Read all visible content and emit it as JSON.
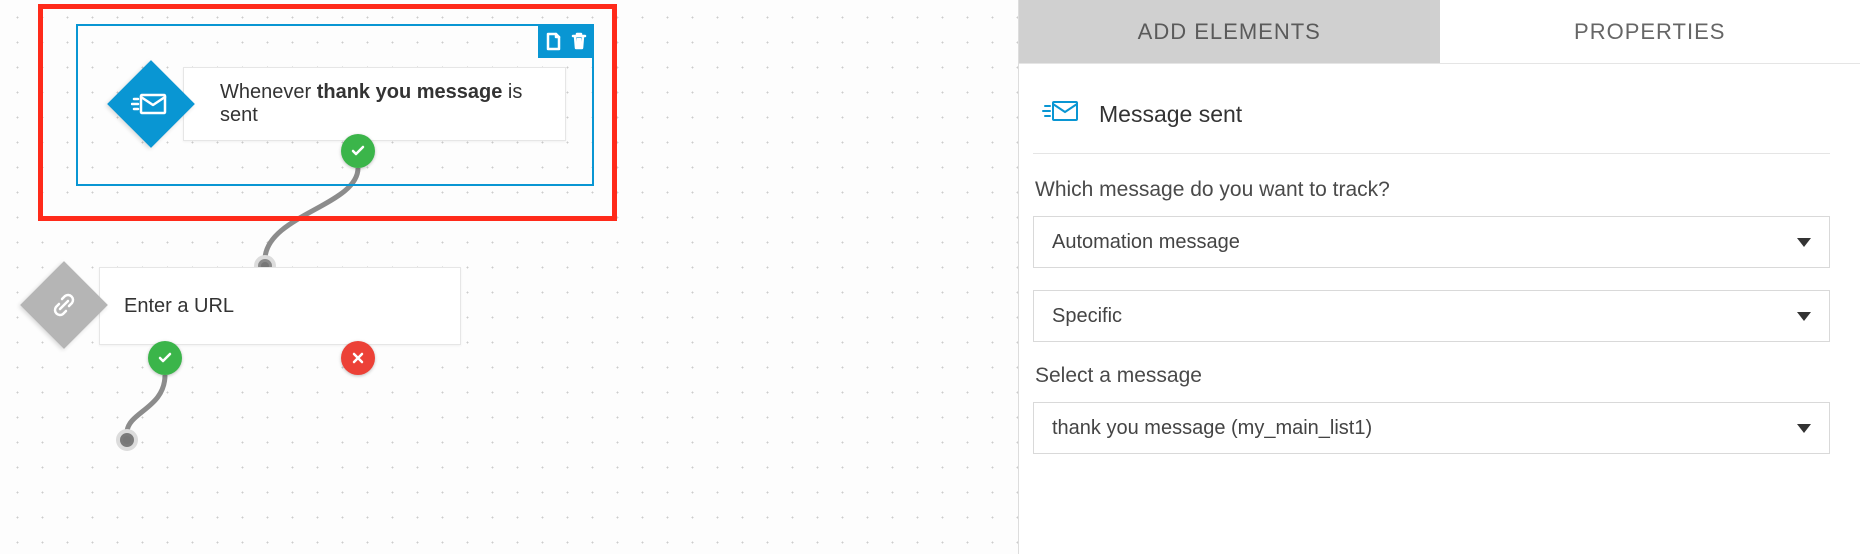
{
  "canvas": {
    "trigger": {
      "prefix": "Whenever ",
      "bold": "thank you message",
      "suffix": " is sent"
    },
    "urlNode": {
      "label": "Enter a URL"
    }
  },
  "tabs": {
    "add_elements": "ADD ELEMENTS",
    "properties": "PROPERTIES"
  },
  "panel": {
    "section_title": "Message sent",
    "q1_label": "Which message do you want to track?",
    "q1_value": "Automation message",
    "q2_value": "Specific",
    "q3_label": "Select a message",
    "q3_value": "thank you message (my_main_list1)"
  }
}
